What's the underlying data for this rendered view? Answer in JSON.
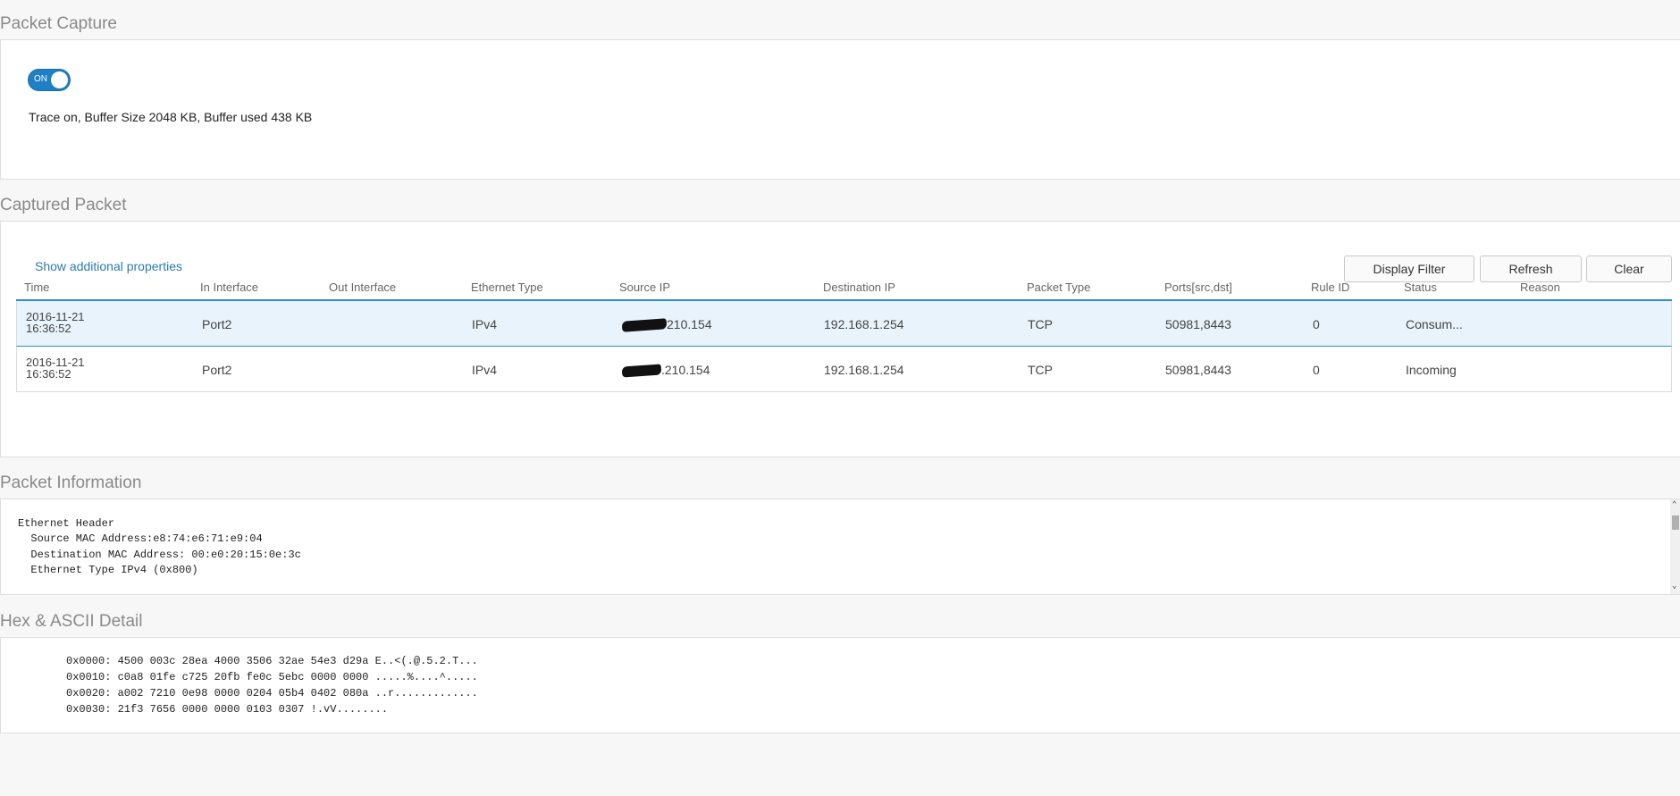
{
  "packet_capture": {
    "title": "Packet Capture",
    "toggle_label": "ON",
    "trace_status": "Trace on, Buffer Size 2048 KB, Buffer used 438 KB"
  },
  "captured_packet": {
    "title": "Captured Packet",
    "show_props_link": "Show additional properties",
    "buttons": {
      "display_filter": "Display Filter",
      "refresh": "Refresh",
      "clear": "Clear"
    },
    "columns": [
      "Time",
      "In Interface",
      "Out Interface",
      "Ethernet Type",
      "Source IP",
      "Destination IP",
      "Packet Type",
      "Ports[src,dst]",
      "Rule ID",
      "Status",
      "Reason"
    ],
    "rows": [
      {
        "time_date": "2016-11-21",
        "time_clock": "16:36:52",
        "in_interface": "Port2",
        "out_interface": "",
        "ethernet_type": "IPv4",
        "source_ip_suffix": "210.154",
        "destination_ip": "192.168.1.254",
        "packet_type": "TCP",
        "ports": "50981,8443",
        "rule_id": "0",
        "status": "Consum...",
        "reason": ""
      },
      {
        "time_date": "2016-11-21",
        "time_clock": "16:36:52",
        "in_interface": "Port2",
        "out_interface": "",
        "ethernet_type": "IPv4",
        "source_ip_suffix": ".210.154",
        "destination_ip": "192.168.1.254",
        "packet_type": "TCP",
        "ports": "50981,8443",
        "rule_id": "0",
        "status": "Incoming",
        "reason": ""
      }
    ]
  },
  "packet_information": {
    "title": "Packet Information",
    "lines": [
      "Ethernet Header",
      "  Source MAC Address:e8:74:e6:71:e9:04",
      "  Destination MAC Address: 00:e0:20:15:0e:3c",
      "  Ethernet Type IPv4 (0x800)"
    ]
  },
  "hex_detail": {
    "title": "Hex & ASCII Detail",
    "lines": [
      "0x0000: 4500 003c 28ea 4000 3506 32ae 54e3 d29a E..<(.@.5.2.T...",
      "0x0010: c0a8 01fe c725 20fb fe0c 5ebc 0000 0000 .....%....^.....",
      "0x0020: a002 7210 0e98 0000 0204 05b4 0402 080a ..r.............",
      "0x0030: 21f3 7656 0000 0000 0103 0307 !.vV........"
    ]
  },
  "colors": {
    "accent": "#1e7fc5",
    "link": "#2a7ab8",
    "selected_row": "#e8f3fb",
    "section_title": "#8a8a8a"
  }
}
